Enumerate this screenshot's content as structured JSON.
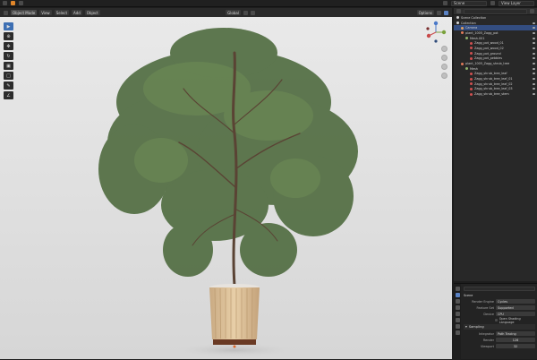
{
  "topbar": {
    "scene": "Scene",
    "view_layer": "View Layer"
  },
  "viewport_header": {
    "mode": "Object Mode",
    "menus": [
      "View",
      "Select",
      "Add",
      "Object"
    ],
    "transform": "Global",
    "options": "Options"
  },
  "outliner": {
    "title": "Scene Collection",
    "rows": [
      {
        "label": "Collection",
        "indent": 0,
        "color": "#d8d8d8",
        "selected": false
      },
      {
        "label": "Camera",
        "indent": 1,
        "color": "#e0a060",
        "selected": true
      },
      {
        "label": "plant_1005_Zagg_pot",
        "indent": 1,
        "color": "#e07a5a",
        "selected": false
      },
      {
        "label": "Mesh.001",
        "indent": 2,
        "color": "#8fb26b",
        "selected": false
      },
      {
        "label": "Zagg_pot_wood_01",
        "indent": 3,
        "color": "#d05050",
        "selected": false
      },
      {
        "label": "Zagg_pot_wood_02",
        "indent": 3,
        "color": "#d05050",
        "selected": false
      },
      {
        "label": "Zagg_pot_ground",
        "indent": 3,
        "color": "#d05050",
        "selected": false
      },
      {
        "label": "Zagg_pot_pebbles",
        "indent": 3,
        "color": "#d05050",
        "selected": false
      },
      {
        "label": "plant_1005_Zagg_shrub_tree",
        "indent": 1,
        "color": "#e07a5a",
        "selected": false
      },
      {
        "label": "Mesh",
        "indent": 2,
        "color": "#8fb26b",
        "selected": false
      },
      {
        "label": "Zagg_shrub_tree_leaf",
        "indent": 3,
        "color": "#d05050",
        "selected": false
      },
      {
        "label": "Zagg_shrub_tree_leaf_01",
        "indent": 3,
        "color": "#d05050",
        "selected": false
      },
      {
        "label": "Zagg_shrub_tree_leaf_02",
        "indent": 3,
        "color": "#d05050",
        "selected": false
      },
      {
        "label": "Zagg_shrub_tree_leaf_03",
        "indent": 3,
        "color": "#d05050",
        "selected": false
      },
      {
        "label": "Zagg_shrub_tree_stem",
        "indent": 3,
        "color": "#d05050",
        "selected": false
      }
    ]
  },
  "properties": {
    "header": "Scene",
    "render_engine_label": "Render Engine",
    "render_engine": "Cycles",
    "feature_set_label": "Feature Set",
    "feature_set": "Supported",
    "device_label": "Device",
    "device": "CPU",
    "osl_label": "Open Shading Language",
    "sampling_label": "Sampling",
    "integrator_label": "Integrator",
    "integrator": "Path Tracing",
    "render_label": "Render",
    "render_samples": "128",
    "viewport_label": "Viewport",
    "viewport_samples": "32"
  },
  "colors": {
    "accent": "#3d6fb3",
    "selection": "#334d80",
    "viewport_bg": "#e3e3e3"
  }
}
